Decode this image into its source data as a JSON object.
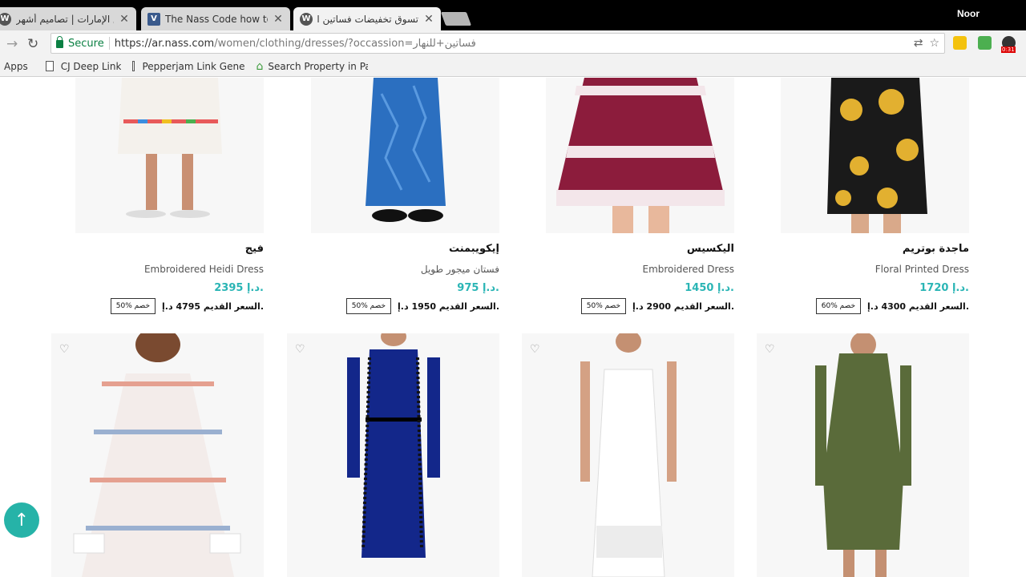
{
  "browser": {
    "tabs": [
      {
        "title": "ناس الإمارات | تصاميم أشهر",
        "favicon": "wordpress-icon"
      },
      {
        "title": "The Nass Code how to us",
        "favicon": "vimeo-icon"
      },
      {
        "title": "تسوق تخفيضات فساتين او",
        "favicon": "wordpress-icon"
      }
    ],
    "profile_name": "Noor",
    "secure_label": "Secure",
    "url_main": "https://ar.nass.com",
    "url_rest": "/women/clothing/dresses/?occassion=فساتين+للنهار",
    "extension_badge": "0:31",
    "bookmarks": [
      {
        "label": "Apps",
        "icon": "apps-icon"
      },
      {
        "label": "CJ Deep Link",
        "icon": "page-icon"
      },
      {
        "label": "Pepperjam Link Gene",
        "icon": "page-icon"
      },
      {
        "label": "Search Property in Pa",
        "icon": "house-icon"
      }
    ]
  },
  "products_row1": [
    {
      "brand": "ماجدة بوتريم",
      "name": "Floral Printed Dress",
      "price": "1720 د.إ.",
      "old_price": "السعر القديم 4300 د.إ.",
      "discount": "60% خصم"
    },
    {
      "brand": "اليكسيس",
      "name": "Embroidered Dress",
      "price": "1450 د.إ.",
      "old_price": "السعر القديم 2900 د.إ.",
      "discount": "50% خصم"
    },
    {
      "brand": "إيكويبمنت",
      "name": "فستان ميجور طويل",
      "price": "975 د.إ.",
      "old_price": "السعر القديم 1950 د.إ.",
      "discount": "50% خصم"
    },
    {
      "brand": "فيج",
      "name": "Embroidered Heidi Dress",
      "price": "2395 د.إ.",
      "old_price": "السعر القديم 4795 د.إ.",
      "discount": "50% خصم"
    }
  ],
  "colors": {
    "accent": "#2ab5b5",
    "scroll_button": "#26b3a8"
  }
}
